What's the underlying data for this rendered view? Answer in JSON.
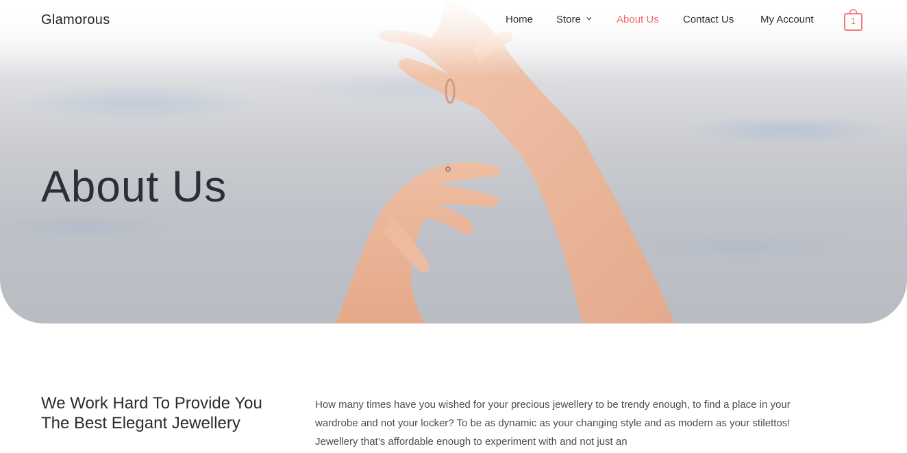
{
  "header": {
    "logo": "Glamorous",
    "nav": {
      "home": "Home",
      "store": "Store",
      "about": "About Us",
      "contact": "Contact Us",
      "account": "My Account"
    },
    "cart_count": "1",
    "active_color": "#f06b6b"
  },
  "hero": {
    "title": "About Us"
  },
  "content": {
    "heading": "We Work Hard To Provide You The Best Elegant Jewellery",
    "paragraph": "How many times have you wished for your precious jewellery to be trendy enough, to find a place in your wardrobe and not your locker? To be as dynamic as your changing style and as modern as your stilettos! Jewellery that’s affordable enough to experiment with and not just an"
  }
}
